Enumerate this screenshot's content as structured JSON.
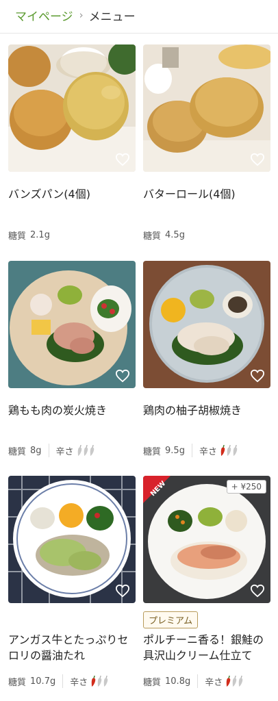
{
  "breadcrumb": {
    "parent": "マイページ",
    "separator": "›",
    "current": "メニュー"
  },
  "labels": {
    "carb": "糖質",
    "spice": "辛さ"
  },
  "colors": {
    "accent": "#5a9a2e",
    "pepper_red": "#d22d1c",
    "pepper_gray": "#c9c9c9"
  },
  "items": [
    {
      "name": "バンズパン(4個)",
      "carb": "2.1g",
      "spice": null,
      "icon": "heart-icon"
    },
    {
      "name": "バターロール(4個)",
      "carb": "4.5g",
      "spice": null,
      "icon": "heart-icon"
    },
    {
      "name": "鶏もも肉の炭火焼き",
      "carb": "8g",
      "spice": 0,
      "icon": "heart-icon"
    },
    {
      "name": "鶏肉の柚子胡椒焼き",
      "carb": "9.5g",
      "spice": 1,
      "icon": "heart-icon"
    },
    {
      "name": "アンガス牛とたっぷりセロリの醤油たれ",
      "carb": "10.7g",
      "spice": 1,
      "icon": "heart-icon"
    },
    {
      "name": "ポルチーニ香る！銀鮭の具沢山クリーム仕立て",
      "carb": "10.8g",
      "spice": 1,
      "icon": "heart-icon",
      "badge_new": "NEW",
      "price_badge": "+ ¥250",
      "premium": "プレミアム"
    }
  ]
}
